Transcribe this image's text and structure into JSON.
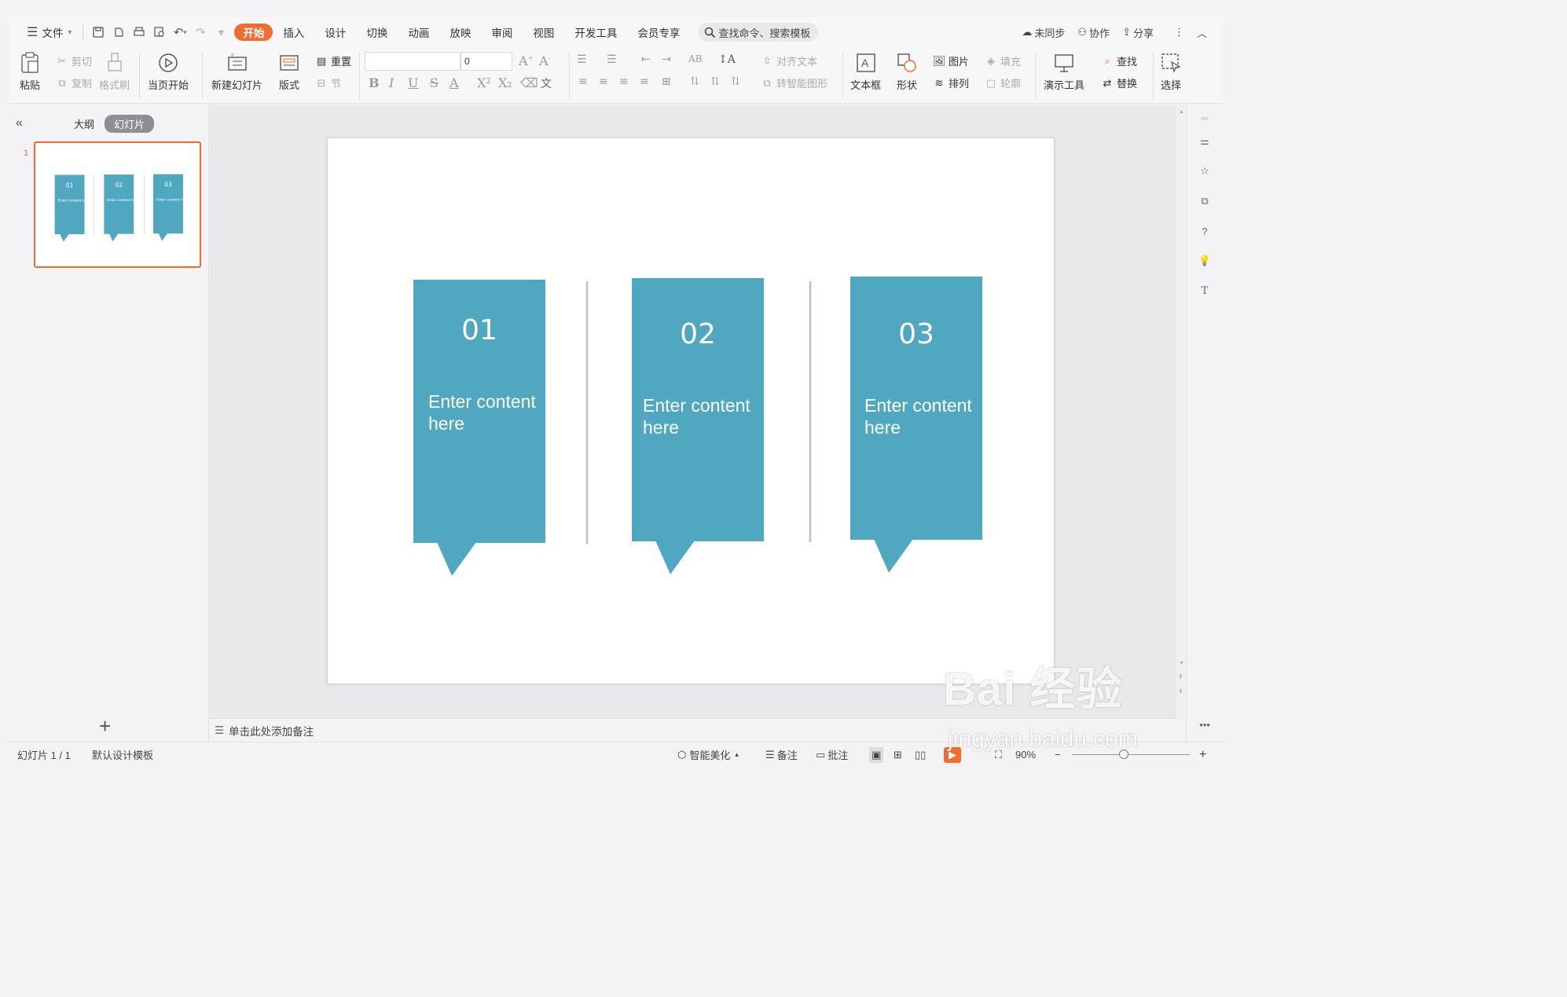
{
  "menu": {
    "file": "文件",
    "tabs": [
      "开始",
      "插入",
      "设计",
      "切换",
      "动画",
      "放映",
      "审阅",
      "视图",
      "开发工具",
      "会员专享"
    ],
    "active_tab": "开始",
    "search_placeholder": "查找命令、搜索模板",
    "right": {
      "sync": "未同步",
      "collab": "协作",
      "share": "分享"
    }
  },
  "ribbon": {
    "paste": "粘贴",
    "cut": "剪切",
    "copy": "复制",
    "format_painter": "格式刷",
    "play_current": "当页开始",
    "new_slide": "新建幻灯片",
    "layout": "版式",
    "reset": "重置",
    "section": "节",
    "font_size": "0",
    "align_text": "对齐文本",
    "smartart": "转智能图形",
    "textbox": "文本框",
    "shape": "形状",
    "picture": "图片",
    "fill": "填充",
    "arrange": "排列",
    "outline": "轮廓",
    "present_tools": "演示工具",
    "find": "查找",
    "replace": "替换",
    "select": "选择"
  },
  "left_panel": {
    "tab_outline": "大纲",
    "tab_slides": "幻灯片",
    "slide_number": "1"
  },
  "slide": {
    "cards": [
      {
        "num": "01",
        "text": "Enter content here"
      },
      {
        "num": "02",
        "text": "Enter content here"
      },
      {
        "num": "03",
        "text": "Enter content here"
      }
    ],
    "card_color": "#4fa8c0"
  },
  "notes_placeholder": "单击此处添加备注",
  "status": {
    "slide_pos": "幻灯片 1 / 1",
    "template": "默认设计模板",
    "beautify": "智能美化",
    "notes": "备注",
    "comments": "批注",
    "zoom": "90%"
  },
  "watermark": {
    "brand": "Bai 经验",
    "url": "jingyan.baidu.com"
  }
}
